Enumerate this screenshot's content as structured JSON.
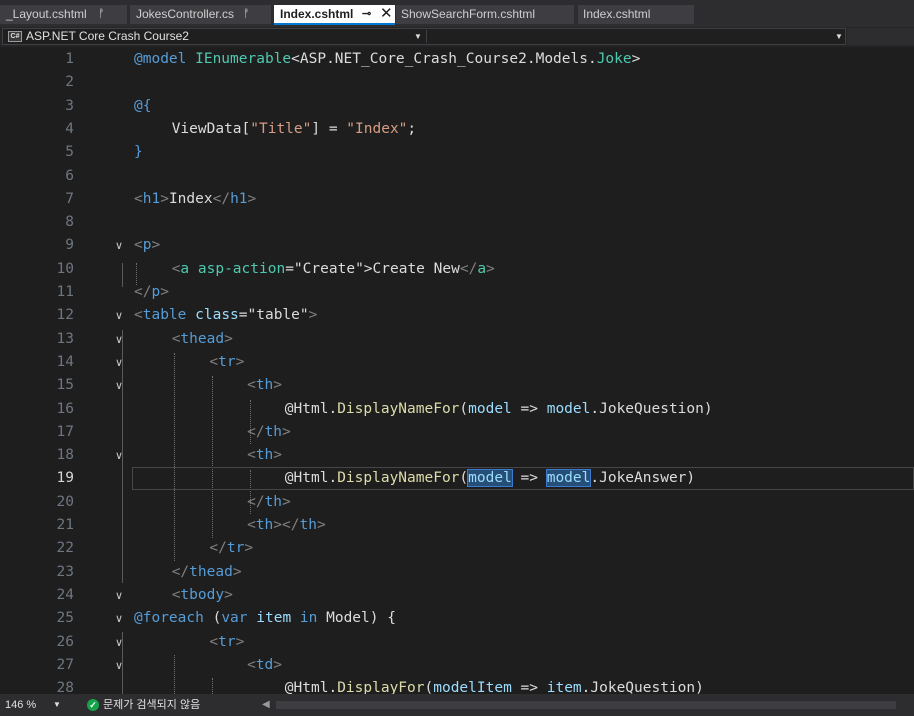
{
  "tabs": [
    {
      "label": "_Layout.cshtml",
      "pin": "ᚡ",
      "active": false
    },
    {
      "label": "JokesController.cs",
      "pin": "ᚡ",
      "active": false
    },
    {
      "label": "Index.cshtml",
      "pin": "⊸",
      "close": "✕",
      "active": true
    },
    {
      "label": "ShowSearchForm.cshtml",
      "active": false
    },
    {
      "label": "Index.cshtml",
      "active": false
    }
  ],
  "navbar": {
    "project_icon": "C#",
    "project": "ASP.NET Core Crash Course2",
    "arrow": "▼"
  },
  "editor": {
    "current_line": 19,
    "lines": [
      {
        "n": "1",
        "fold": ""
      },
      {
        "n": "2",
        "fold": ""
      },
      {
        "n": "3",
        "fold": ""
      },
      {
        "n": "4",
        "fold": ""
      },
      {
        "n": "5",
        "fold": ""
      },
      {
        "n": "6",
        "fold": ""
      },
      {
        "n": "7",
        "fold": ""
      },
      {
        "n": "8",
        "fold": ""
      },
      {
        "n": "9",
        "fold": "v"
      },
      {
        "n": "10",
        "fold": ""
      },
      {
        "n": "11",
        "fold": ""
      },
      {
        "n": "12",
        "fold": "v"
      },
      {
        "n": "13",
        "fold": "v"
      },
      {
        "n": "14",
        "fold": "v"
      },
      {
        "n": "15",
        "fold": "v"
      },
      {
        "n": "16",
        "fold": ""
      },
      {
        "n": "17",
        "fold": ""
      },
      {
        "n": "18",
        "fold": "v"
      },
      {
        "n": "19",
        "fold": ""
      },
      {
        "n": "20",
        "fold": ""
      },
      {
        "n": "21",
        "fold": ""
      },
      {
        "n": "22",
        "fold": ""
      },
      {
        "n": "23",
        "fold": ""
      },
      {
        "n": "24",
        "fold": "v"
      },
      {
        "n": "25",
        "fold": "v"
      },
      {
        "n": "26",
        "fold": "v"
      },
      {
        "n": "27",
        "fold": "v"
      },
      {
        "n": "28",
        "fold": ""
      }
    ],
    "code": [
      {
        "line": 1,
        "indent": 0,
        "tokens": [
          [
            "@model",
            "#569cd6"
          ],
          [
            " IEnumerable",
            "#4ec9b0"
          ],
          [
            "<",
            "#dcdcdc"
          ],
          [
            "ASP.NET_Core_Crash_Course2.Models.",
            "#dcdcdc"
          ],
          [
            "Joke",
            "#4ec9b0"
          ],
          [
            ">",
            "#dcdcdc"
          ]
        ]
      },
      {
        "line": 3,
        "indent": 0,
        "tokens": [
          [
            "@{",
            "#569cd6"
          ]
        ]
      },
      {
        "line": 4,
        "indent": 1,
        "tokens": [
          [
            "ViewData",
            "#dcdcdc"
          ],
          [
            "[",
            "#dcdcdc"
          ],
          [
            "\"Title\"",
            "#d69d85"
          ],
          [
            "] = ",
            "#dcdcdc"
          ],
          [
            "\"Index\"",
            "#d69d85"
          ],
          [
            ";",
            "#dcdcdc"
          ]
        ]
      },
      {
        "line": 5,
        "indent": 0,
        "tokens": [
          [
            "}",
            "#569cd6"
          ]
        ]
      },
      {
        "line": 7,
        "indent": 0,
        "tokens": [
          [
            "<",
            "#808080"
          ],
          [
            "h1",
            "#569cd6"
          ],
          [
            ">",
            "#808080"
          ],
          [
            "Index",
            "#dcdcdc"
          ],
          [
            "</",
            "#808080"
          ],
          [
            "h1",
            "#569cd6"
          ],
          [
            ">",
            "#808080"
          ]
        ]
      },
      {
        "line": 9,
        "indent": 0,
        "tokens": [
          [
            "<",
            "#808080"
          ],
          [
            "p",
            "#569cd6"
          ],
          [
            ">",
            "#808080"
          ]
        ]
      },
      {
        "line": 10,
        "indent": 1,
        "tokens": [
          [
            "<",
            "#808080"
          ],
          [
            "a ",
            "#4ec9b0"
          ],
          [
            "asp-action",
            "#4ec9b0"
          ],
          [
            "=\"",
            "#dcdcdc"
          ],
          [
            "Create",
            "#dcdcdc"
          ],
          [
            "\">",
            "#dcdcdc"
          ],
          [
            "Create New",
            "#dcdcdc"
          ],
          [
            "</",
            "#808080"
          ],
          [
            "a",
            "#4ec9b0"
          ],
          [
            ">",
            "#808080"
          ]
        ]
      },
      {
        "line": 11,
        "indent": 0,
        "tokens": [
          [
            "</",
            "#808080"
          ],
          [
            "p",
            "#569cd6"
          ],
          [
            ">",
            "#808080"
          ]
        ]
      },
      {
        "line": 12,
        "indent": 0,
        "tokens": [
          [
            "<",
            "#808080"
          ],
          [
            "table ",
            "#569cd6"
          ],
          [
            "class",
            "#9cdcfe"
          ],
          [
            "=\"table\"",
            "#dcdcdc"
          ],
          [
            ">",
            "#808080"
          ]
        ]
      },
      {
        "line": 13,
        "indent": 1,
        "tokens": [
          [
            "<",
            "#808080"
          ],
          [
            "thead",
            "#569cd6"
          ],
          [
            ">",
            "#808080"
          ]
        ]
      },
      {
        "line": 14,
        "indent": 2,
        "tokens": [
          [
            "<",
            "#808080"
          ],
          [
            "tr",
            "#569cd6"
          ],
          [
            ">",
            "#808080"
          ]
        ]
      },
      {
        "line": 15,
        "indent": 3,
        "tokens": [
          [
            "<",
            "#808080"
          ],
          [
            "th",
            "#569cd6"
          ],
          [
            ">",
            "#808080"
          ]
        ]
      },
      {
        "line": 16,
        "indent": 4,
        "tokens": [
          [
            "@Html",
            "#dcdcdc"
          ],
          [
            ".",
            "#dcdcdc"
          ],
          [
            "DisplayNameFor",
            "#dcdcaa"
          ],
          [
            "(",
            "#dcdcdc"
          ],
          [
            "model",
            "#9cdcfe"
          ],
          [
            " => ",
            "#dcdcdc"
          ],
          [
            "model",
            "#9cdcfe"
          ],
          [
            ".JokeQuestion)",
            "#dcdcdc"
          ]
        ]
      },
      {
        "line": 17,
        "indent": 3,
        "tokens": [
          [
            "</",
            "#808080"
          ],
          [
            "th",
            "#569cd6"
          ],
          [
            ">",
            "#808080"
          ]
        ]
      },
      {
        "line": 18,
        "indent": 3,
        "tokens": [
          [
            "<",
            "#808080"
          ],
          [
            "th",
            "#569cd6"
          ],
          [
            ">",
            "#808080"
          ]
        ]
      },
      {
        "line": 19,
        "indent": 4,
        "tokens": [
          [
            "@Html",
            "#dcdcdc"
          ],
          [
            ".",
            "#dcdcdc"
          ],
          [
            "DisplayNameFor",
            "#dcdcaa"
          ],
          [
            "(",
            "#dcdcdc"
          ],
          [
            "model",
            "#9cdcfe",
            "hl"
          ],
          [
            " => ",
            "#dcdcdc"
          ],
          [
            "model",
            "#9cdcfe",
            "hl"
          ],
          [
            ".JokeAnswer)",
            "#dcdcdc"
          ]
        ]
      },
      {
        "line": 20,
        "indent": 3,
        "tokens": [
          [
            "</",
            "#808080"
          ],
          [
            "th",
            "#569cd6"
          ],
          [
            ">",
            "#808080"
          ]
        ]
      },
      {
        "line": 21,
        "indent": 3,
        "tokens": [
          [
            "<",
            "#808080"
          ],
          [
            "th",
            "#569cd6"
          ],
          [
            "></",
            "#808080"
          ],
          [
            "th",
            "#569cd6"
          ],
          [
            ">",
            "#808080"
          ]
        ]
      },
      {
        "line": 22,
        "indent": 2,
        "tokens": [
          [
            "</",
            "#808080"
          ],
          [
            "tr",
            "#569cd6"
          ],
          [
            ">",
            "#808080"
          ]
        ]
      },
      {
        "line": 23,
        "indent": 1,
        "tokens": [
          [
            "</",
            "#808080"
          ],
          [
            "thead",
            "#569cd6"
          ],
          [
            ">",
            "#808080"
          ]
        ]
      },
      {
        "line": 24,
        "indent": 1,
        "tokens": [
          [
            "<",
            "#808080"
          ],
          [
            "tbody",
            "#569cd6"
          ],
          [
            ">",
            "#808080"
          ]
        ]
      },
      {
        "line": 25,
        "indent": 0,
        "tokens": [
          [
            "@foreach",
            "#569cd6"
          ],
          [
            " (",
            "#dcdcdc"
          ],
          [
            "var",
            "#569cd6"
          ],
          [
            " ",
            "#dcdcdc"
          ],
          [
            "item",
            "#9cdcfe"
          ],
          [
            " ",
            "#dcdcdc"
          ],
          [
            "in",
            "#569cd6"
          ],
          [
            " Model) {",
            "#dcdcdc"
          ]
        ]
      },
      {
        "line": 26,
        "indent": 2,
        "tokens": [
          [
            "<",
            "#808080"
          ],
          [
            "tr",
            "#569cd6"
          ],
          [
            ">",
            "#808080"
          ]
        ]
      },
      {
        "line": 27,
        "indent": 3,
        "tokens": [
          [
            "<",
            "#808080"
          ],
          [
            "td",
            "#569cd6"
          ],
          [
            ">",
            "#808080"
          ]
        ]
      },
      {
        "line": 28,
        "indent": 4,
        "tokens": [
          [
            "@Html",
            "#dcdcdc"
          ],
          [
            ".",
            "#dcdcdc"
          ],
          [
            "DisplayFor",
            "#dcdcaa"
          ],
          [
            "(",
            "#dcdcdc"
          ],
          [
            "modelItem",
            "#9cdcfe"
          ],
          [
            " => ",
            "#dcdcdc"
          ],
          [
            "item",
            "#9cdcfe"
          ],
          [
            ".JokeQuestion)",
            "#dcdcdc"
          ]
        ]
      }
    ]
  },
  "statusbar": {
    "zoom": "146 %",
    "zoom_arrow": "▼",
    "ok_icon": "✓",
    "issues": "문제가 검색되지 않음",
    "scroll_left": "◀"
  }
}
